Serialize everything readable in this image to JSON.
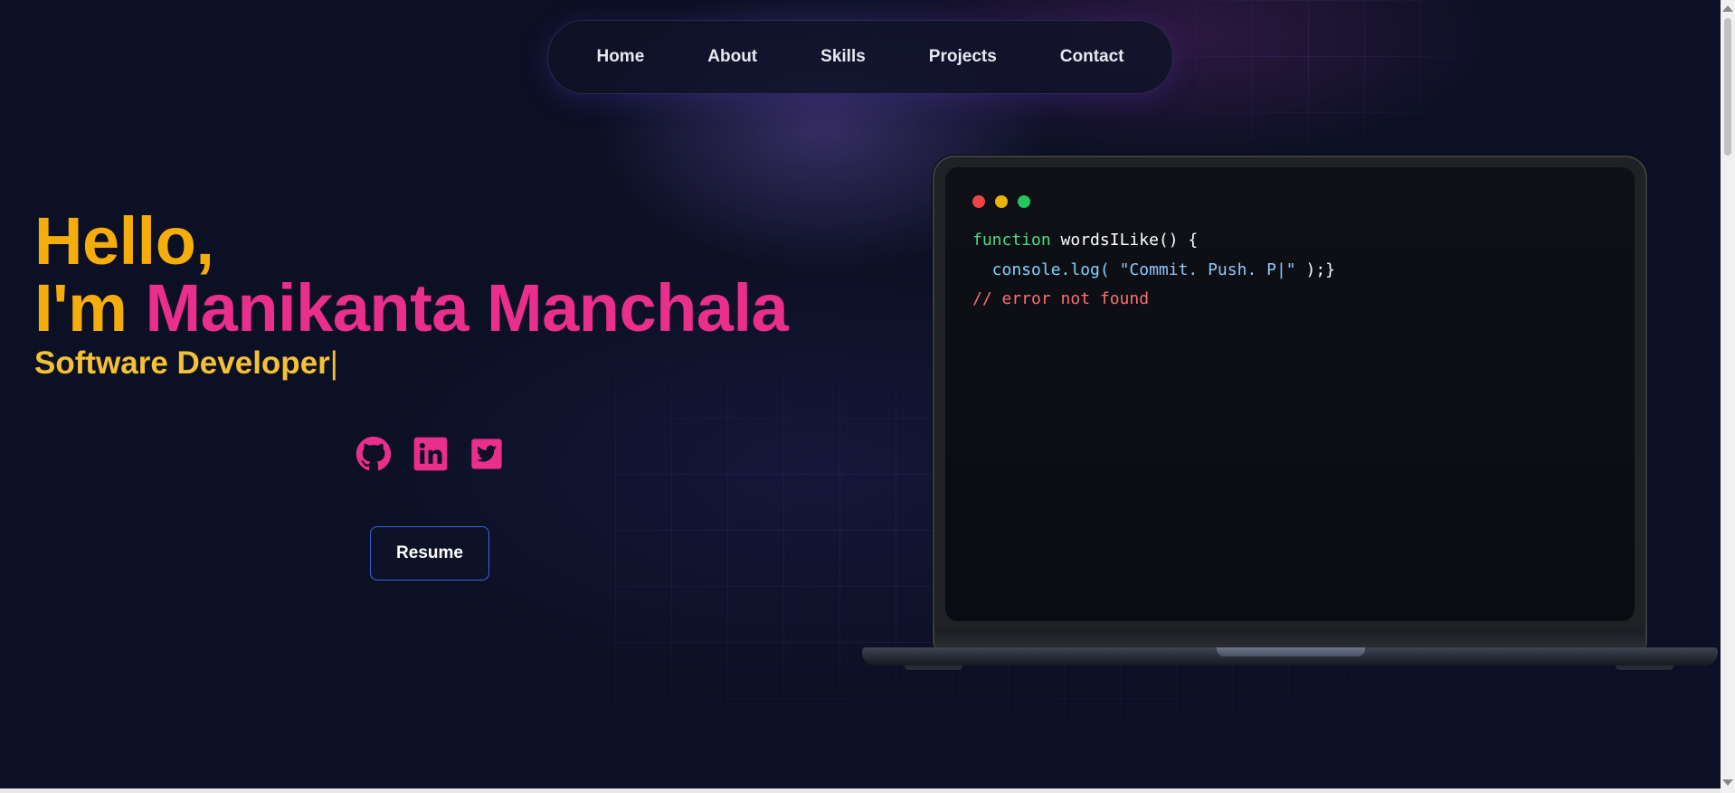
{
  "nav": {
    "items": [
      {
        "label": "Home"
      },
      {
        "label": "About"
      },
      {
        "label": "Skills"
      },
      {
        "label": "Projects"
      },
      {
        "label": "Contact"
      }
    ]
  },
  "hero": {
    "greeting": "Hello,",
    "im_prefix": "I'm ",
    "name": "Manikanta Manchala",
    "role": "Software Developer",
    "cursor": "|",
    "resume_label": "Resume"
  },
  "social": {
    "items": [
      {
        "icon": "github-icon"
      },
      {
        "icon": "linkedin-icon"
      },
      {
        "icon": "twitter-icon"
      }
    ]
  },
  "code_window": {
    "lines": [
      [
        {
          "text": "function ",
          "color": "#4ade80"
        },
        {
          "text": "wordsILike() {",
          "color": "#ffffff"
        }
      ],
      [
        {
          "text": "  console.log( ",
          "color": "#7dd3fc"
        },
        {
          "text": "\"Commit. Push. P|\"",
          "color": "#93c5fd"
        },
        {
          "text": " );}",
          "color": "#ffffff"
        }
      ],
      [
        {
          "text": "// error not found",
          "color": "#f87171"
        }
      ]
    ],
    "line1_a": "function ",
    "line1_b": "wordsILike() {",
    "line2_a": "  console.log( ",
    "line2_b": "\"Commit. Push. P|\"",
    "line2_c": " );}",
    "line3": "// error not found"
  },
  "colors": {
    "background": "#0c1024",
    "accent_yellow": "#f5ad0c",
    "accent_pink": "#ea2e8c",
    "role_yellow": "#f4c036",
    "button_border": "#3b63e0",
    "dot_red": "#ef4444",
    "dot_yellow": "#eab308",
    "dot_green": "#22c55e"
  }
}
